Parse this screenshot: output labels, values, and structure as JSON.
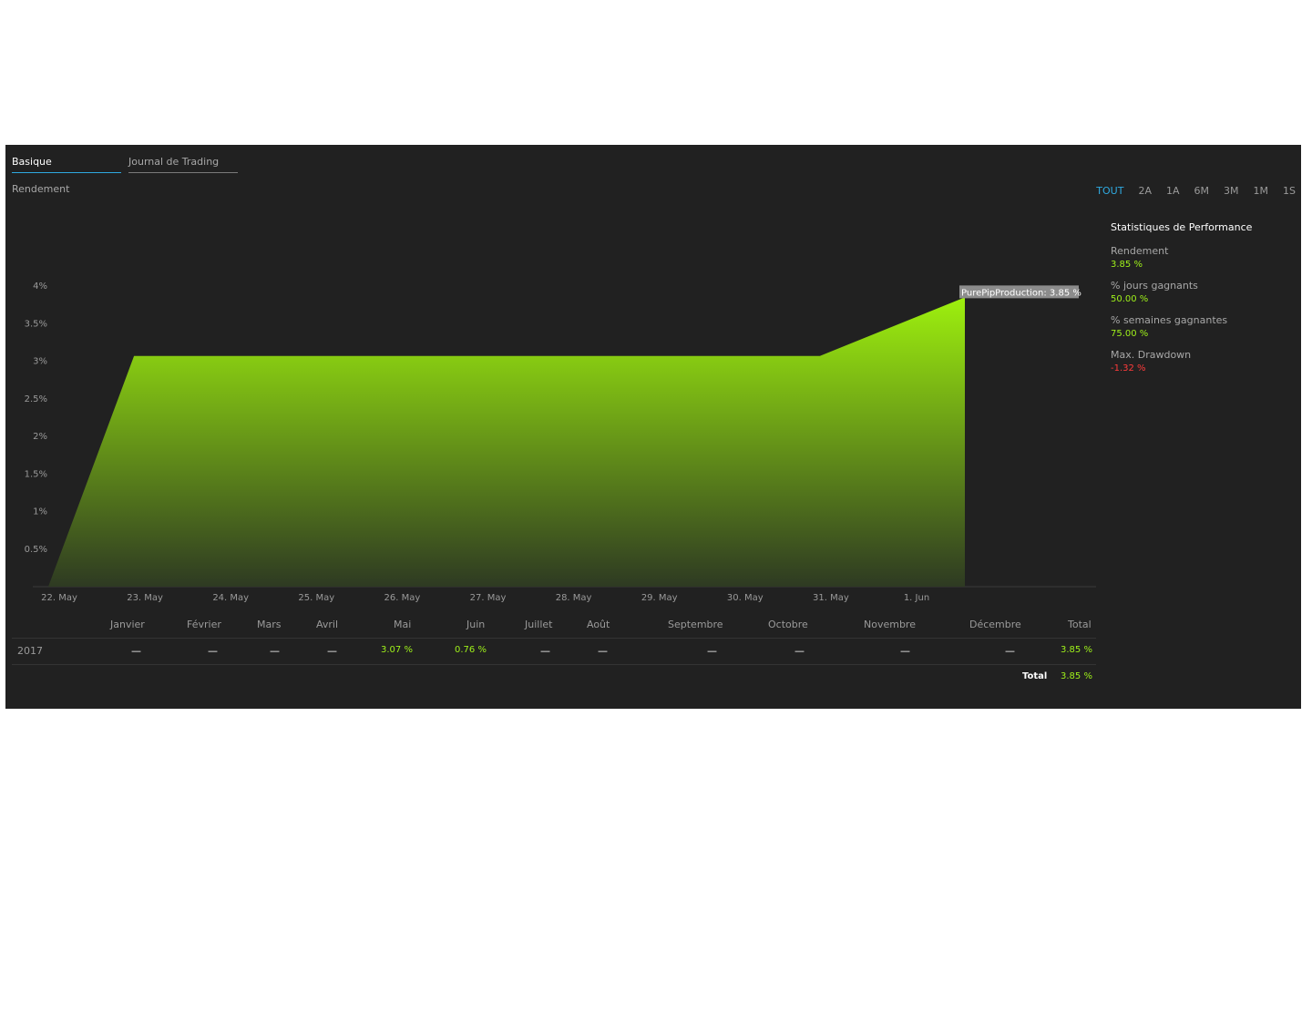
{
  "tabs": [
    {
      "label": "Basique",
      "active": true
    },
    {
      "label": "Journal de Trading",
      "active": false
    }
  ],
  "chart_title_label": "Rendement",
  "ranges": [
    {
      "label": "TOUT",
      "active": true
    },
    {
      "label": "2A",
      "active": false
    },
    {
      "label": "1A",
      "active": false
    },
    {
      "label": "6M",
      "active": false
    },
    {
      "label": "3M",
      "active": false
    },
    {
      "label": "1M",
      "active": false
    },
    {
      "label": "1S",
      "active": false
    }
  ],
  "stats": {
    "title": "Statistiques de Performance",
    "items": [
      {
        "label": "Rendement",
        "value": "3.85 %",
        "color": "#9ef01a"
      },
      {
        "label": "% jours gagnants",
        "value": "50.00 %",
        "color": "#9ef01a"
      },
      {
        "label": "% semaines gagnantes",
        "value": "75.00 %",
        "color": "#9ef01a"
      },
      {
        "label": "Max. Drawdown",
        "value": "-1.32 %",
        "color": "#ff3b3b"
      }
    ]
  },
  "colors": {
    "accent": "#2fa9e0",
    "positive": "#9ef01a",
    "negative": "#ff3b3b",
    "background": "#212121"
  },
  "chart_data": {
    "type": "area",
    "x": [
      "22. May",
      "23. May",
      "31. May",
      "1. Jun"
    ],
    "series": [
      {
        "name": "PurePipProduction",
        "values": [
          0,
          3.07,
          3.07,
          3.85
        ]
      }
    ],
    "x_ticks": [
      "22. May",
      "23. May",
      "24. May",
      "25. May",
      "26. May",
      "27. May",
      "28. May",
      "29. May",
      "30. May",
      "31. May",
      "1. Jun"
    ],
    "y_ticks": [
      "0.5%",
      "1%",
      "1.5%",
      "2%",
      "2.5%",
      "3%",
      "3.5%",
      "4%"
    ],
    "ylim": [
      0,
      4
    ],
    "tooltip": "PurePipProduction: 3.85 %",
    "last_x": "1. Jun",
    "fill_top_color": "#9ef00e",
    "fill_bottom_color": "#2e3a22"
  },
  "monthly": {
    "headers": [
      "Janvier",
      "Février",
      "Mars",
      "Avril",
      "Mai",
      "Juin",
      "Juillet",
      "Août",
      "Septembre",
      "Octobre",
      "Novembre",
      "Décembre",
      "Total"
    ],
    "rows": [
      {
        "year": "2017",
        "values": [
          "—",
          "—",
          "—",
          "—",
          "3.07 %",
          "0.76 %",
          "—",
          "—",
          "—",
          "—",
          "—",
          "—",
          "3.85 %"
        ]
      }
    ],
    "total_label": "Total",
    "total_value": "3.85 %"
  }
}
